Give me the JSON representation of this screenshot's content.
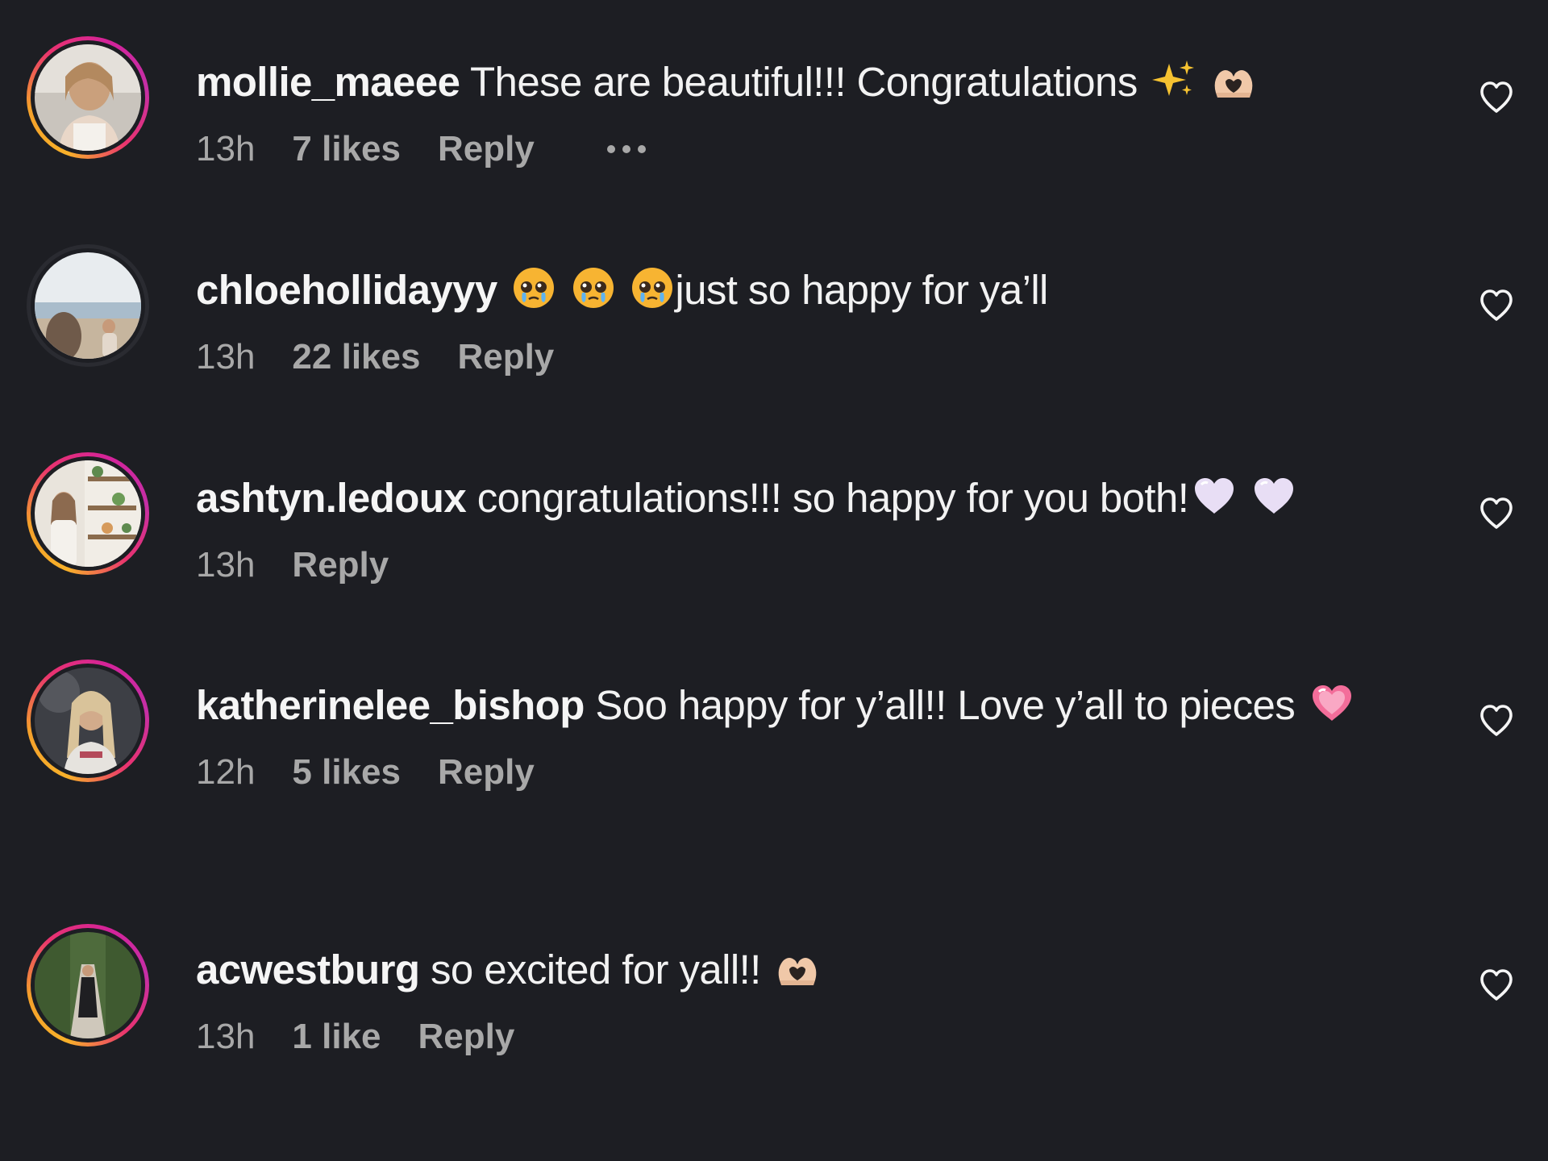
{
  "colors": {
    "background": "#1d1e23",
    "text": "#f2f2f2",
    "meta": "#a8a8a8",
    "story_ring_start": "#f8b12a",
    "story_ring_end": "#c52fa6"
  },
  "comments": [
    {
      "username": "mollie_maeee",
      "text": "These are beautiful!!! Congratulations",
      "emojis": [
        "sparkles-emoji",
        "heart-hands-emoji"
      ],
      "time": "13h",
      "likes": "7 likes",
      "reply": "Reply",
      "has_more_menu": true,
      "story_ring": true,
      "like_icon": "heart-outline-icon"
    },
    {
      "username": "chloehollidayyy",
      "text": "just so happy for ya’ll",
      "emojis": [
        "pleading-tears-emoji",
        "pleading-tears-emoji",
        "pleading-tears-emoji"
      ],
      "time": "13h",
      "likes": "22 likes",
      "reply": "Reply",
      "has_more_menu": false,
      "story_ring": false,
      "like_icon": "heart-outline-icon"
    },
    {
      "username": "ashtyn.ledoux",
      "text": "congratulations!!! so happy for you both!",
      "emojis": [
        "white-heart-emoji",
        "white-heart-emoji"
      ],
      "time": "13h",
      "likes": "",
      "reply": "Reply",
      "has_more_menu": false,
      "story_ring": true,
      "like_icon": "heart-outline-icon"
    },
    {
      "username": "katherinelee_bishop",
      "text": "Soo happy for y’all!! Love y’all to pieces",
      "emojis": [
        "growing-heart-emoji"
      ],
      "time": "12h",
      "likes": "5 likes",
      "reply": "Reply",
      "has_more_menu": false,
      "story_ring": true,
      "like_icon": "heart-outline-icon"
    },
    {
      "username": "acwestburg",
      "text": "so excited for yall!!",
      "emojis": [
        "heart-hands-emoji"
      ],
      "time": "13h",
      "likes": "1 like",
      "reply": "Reply",
      "has_more_menu": false,
      "story_ring": true,
      "like_icon": "heart-outline-icon"
    }
  ]
}
